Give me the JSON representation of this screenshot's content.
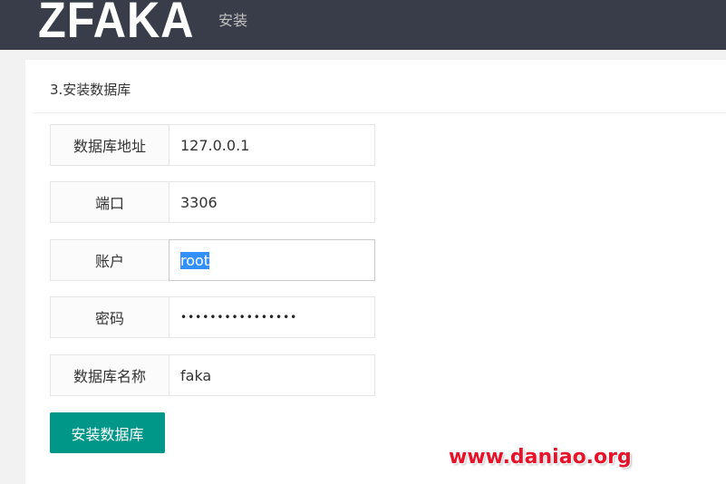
{
  "header": {
    "logo": "ZFAKA",
    "nav_install": "安装"
  },
  "step_title": "3.安装数据库",
  "form": {
    "db_host": {
      "label": "数据库地址",
      "value": "127.0.0.1"
    },
    "db_port": {
      "label": "端口",
      "value": "3306"
    },
    "db_user": {
      "label": "账户",
      "value": "root"
    },
    "db_password": {
      "label": "密码",
      "value": "••••••••••••••••"
    },
    "db_name": {
      "label": "数据库名称",
      "value": "faka"
    }
  },
  "install_button": "安装数据库",
  "watermark": "www.daniao.org",
  "colors": {
    "header_bg": "#393d49",
    "button": "#009688",
    "watermark": "#e8132a"
  }
}
